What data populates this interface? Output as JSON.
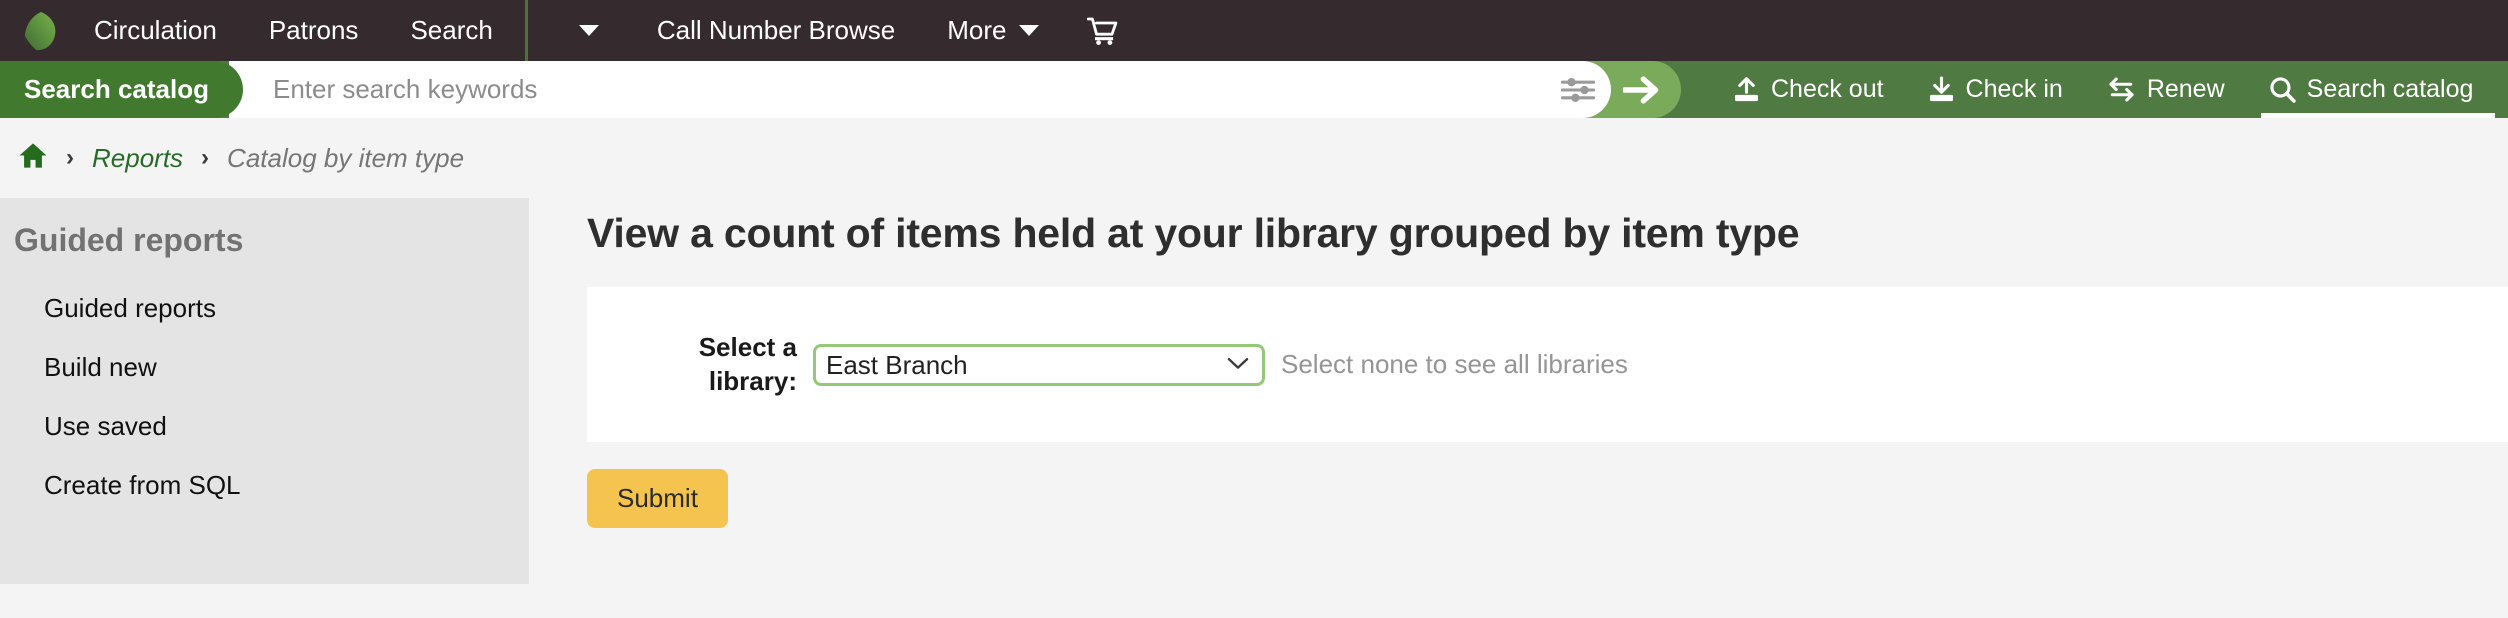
{
  "navbar": {
    "logo_icon": "koha-leaf-logo",
    "items": [
      {
        "label": "Circulation",
        "icon": null,
        "caret": false
      },
      {
        "label": "Patrons",
        "icon": null,
        "caret": false
      },
      {
        "label": "Search",
        "icon": null,
        "caret": false
      }
    ],
    "caret_toggle_icon": "chevron-down-icon",
    "items_right": [
      {
        "label": "Call Number Browse",
        "caret": false
      },
      {
        "label": "More",
        "caret": true
      }
    ],
    "cart_icon": "shopping-cart-icon",
    "divider_color": "#417a2f",
    "background": "#352b2e"
  },
  "search": {
    "pill_label": "Search catalog",
    "placeholder": "Enter search keywords",
    "value": "",
    "filter_icon": "sliders-filter-icon",
    "submit_icon": "arrow-right-icon",
    "bar_background": "#4f7a42",
    "pill_background": "#417a2f",
    "submit_background": "#7aab5a"
  },
  "quick_actions": [
    {
      "label": "Check out",
      "icon": "upload-arrow-icon",
      "active": false
    },
    {
      "label": "Check in",
      "icon": "download-arrow-icon",
      "active": false
    },
    {
      "label": "Renew",
      "icon": "exchange-arrows-icon",
      "active": false
    },
    {
      "label": "Search catalog",
      "icon": "magnifier-icon",
      "active": true
    }
  ],
  "breadcrumb": {
    "home_icon": "home-icon",
    "separator": "›",
    "link": "Reports",
    "current": "Catalog by item type",
    "link_color": "#286b28",
    "current_color": "#767676"
  },
  "sidebar": {
    "title": "Guided reports",
    "items": [
      {
        "label": "Guided reports"
      },
      {
        "label": "Build new"
      },
      {
        "label": "Use saved"
      },
      {
        "label": "Create from SQL"
      }
    ],
    "background": "#e4e4e4"
  },
  "main": {
    "page_title": "View a count of items held at your library grouped by item type",
    "form": {
      "library_label": "Select a library:",
      "library_selected": "East Branch",
      "library_options": [
        "East Branch"
      ],
      "library_caret_icon": "chevron-down-icon",
      "hint": "Select none to see all libraries",
      "select_border_color": "#94c978"
    },
    "submit_label": "Submit",
    "submit_color": "#f5c44e"
  }
}
